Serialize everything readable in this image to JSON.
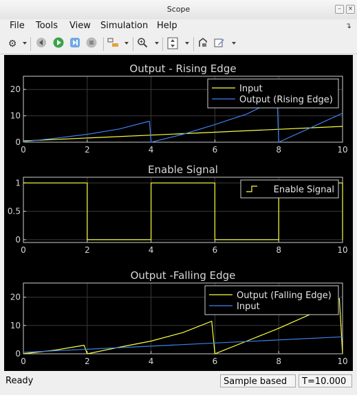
{
  "window": {
    "title": "Scope"
  },
  "menu": [
    "File",
    "Tools",
    "View",
    "Simulation",
    "Help"
  ],
  "toolbar_icons": [
    "gear-icon",
    "rewind-icon",
    "play-icon",
    "step-forward-icon",
    "stop-icon",
    "highlight-icon",
    "zoom-icon",
    "autoscale-icon",
    "restore-icon",
    "edit-icon"
  ],
  "status": {
    "left": "Ready",
    "mode": "Sample based",
    "time": "T=10.000"
  },
  "colors": {
    "background": "#000000",
    "axes": "#FFFFFF",
    "grid": "#3A3A3A",
    "yellow": "#FFFF3F",
    "blue": "#3C82F0",
    "plot_bg": "#000000"
  },
  "chart_data": [
    {
      "type": "line",
      "title": "Output - Rising Edge",
      "xlim": [
        0,
        10
      ],
      "ylim": [
        0,
        25
      ],
      "xticks": [
        "0",
        "2",
        "4",
        "6",
        "8",
        "10"
      ],
      "yticks": [
        "0",
        "10",
        "20"
      ],
      "legend_position": "top-right",
      "series": [
        {
          "name": "Input",
          "color": "yellow",
          "x": [
            0,
            10
          ],
          "y": [
            0.5,
            6
          ]
        },
        {
          "name": "Output (Rising Edge)",
          "color": "blue",
          "x": [
            0,
            0.1,
            1,
            2,
            3,
            3.9,
            3.95,
            4,
            5,
            6,
            7,
            7.9,
            7.95,
            8,
            9,
            10
          ],
          "y": [
            0,
            0.3,
            1.5,
            3,
            5,
            7.8,
            7.9,
            0,
            3,
            6.7,
            10.7,
            16,
            16.2,
            0,
            5.5,
            11
          ]
        }
      ]
    },
    {
      "type": "line",
      "title": "Enable Signal",
      "xlim": [
        0,
        10
      ],
      "ylim": [
        -0.05,
        1.1
      ],
      "xticks": [
        "0",
        "2",
        "4",
        "6",
        "8",
        "10"
      ],
      "yticks": [
        "0",
        "0.5",
        "1"
      ],
      "legend_position": "top-right",
      "series": [
        {
          "name": "Enable Signal",
          "color": "yellow",
          "x": [
            0,
            2,
            2,
            4,
            4,
            6,
            6,
            8,
            8,
            10,
            10
          ],
          "y": [
            1,
            1,
            0,
            0,
            1,
            1,
            0,
            0,
            1,
            1,
            0
          ]
        }
      ]
    },
    {
      "type": "line",
      "title": "Output -Falling Edge",
      "xlim": [
        0,
        10
      ],
      "ylim": [
        0,
        25
      ],
      "xticks": [
        "0",
        "2",
        "4",
        "6",
        "8",
        "10"
      ],
      "yticks": [
        "0",
        "10",
        "20"
      ],
      "legend_position": "top-right",
      "series": [
        {
          "name": "Output (Falling Edge)",
          "color": "yellow",
          "x": [
            0,
            1,
            1.9,
            2,
            3,
            4,
            5,
            5.9,
            6,
            7,
            8,
            9,
            9.8,
            9.9,
            10
          ],
          "y": [
            0,
            1.3,
            3,
            0,
            2.3,
            4.5,
            7.5,
            11.5,
            0,
            4.5,
            9,
            14,
            19,
            19.5,
            0
          ]
        },
        {
          "name": "Input",
          "color": "blue",
          "x": [
            0,
            10
          ],
          "y": [
            0.5,
            6
          ]
        }
      ]
    }
  ]
}
